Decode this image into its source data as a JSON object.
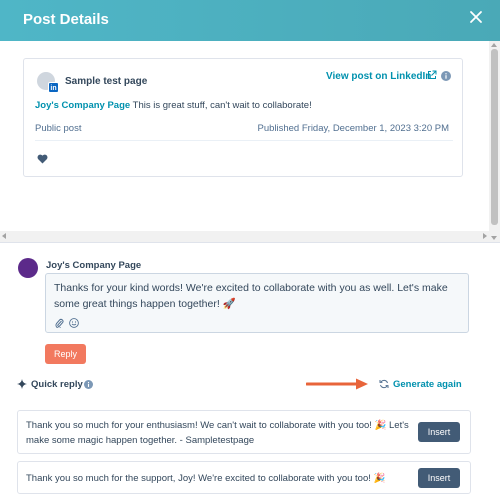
{
  "header": {
    "title": "Post Details"
  },
  "post": {
    "account_name": "Sample test page",
    "view_link": "View post on LinkedIn",
    "author": "Joy's Company Page",
    "comment": "This is great stuff, can't wait to collaborate!",
    "visibility": "Public post",
    "published": "Published Friday, December 1, 2023 3:20 PM",
    "network_badge": "in"
  },
  "reply": {
    "account_name": "Joy's Company Page",
    "text": "Thanks for your kind words! We're excited to collaborate with you as well. Let's make some great things happen together! 🚀",
    "button": "Reply"
  },
  "quick_reply": {
    "label": "Quick reply",
    "generate_again": "Generate again",
    "suggestions": [
      {
        "text": "Thank you so much for your enthusiasm! We can't wait to collaborate with you too! 🎉 Let's make some magic happen together. - Sampletestpage",
        "button": "Insert"
      },
      {
        "text": "Thank you so much for the support, Joy! We're excited to collaborate with you too! 🎉",
        "button": "Insert"
      }
    ]
  },
  "colors": {
    "header": "#4fb6c7",
    "link": "#0091ae",
    "reply_button": "#f2795f",
    "insert_button": "#425b76",
    "annotation_arrow": "#e8643a"
  },
  "icons": [
    "close-icon",
    "linkedin-icon",
    "external-link-icon",
    "info-icon",
    "heart-icon",
    "attach-icon",
    "emoji-icon",
    "sparkle-icon",
    "refresh-icon",
    "arrow-icon"
  ]
}
